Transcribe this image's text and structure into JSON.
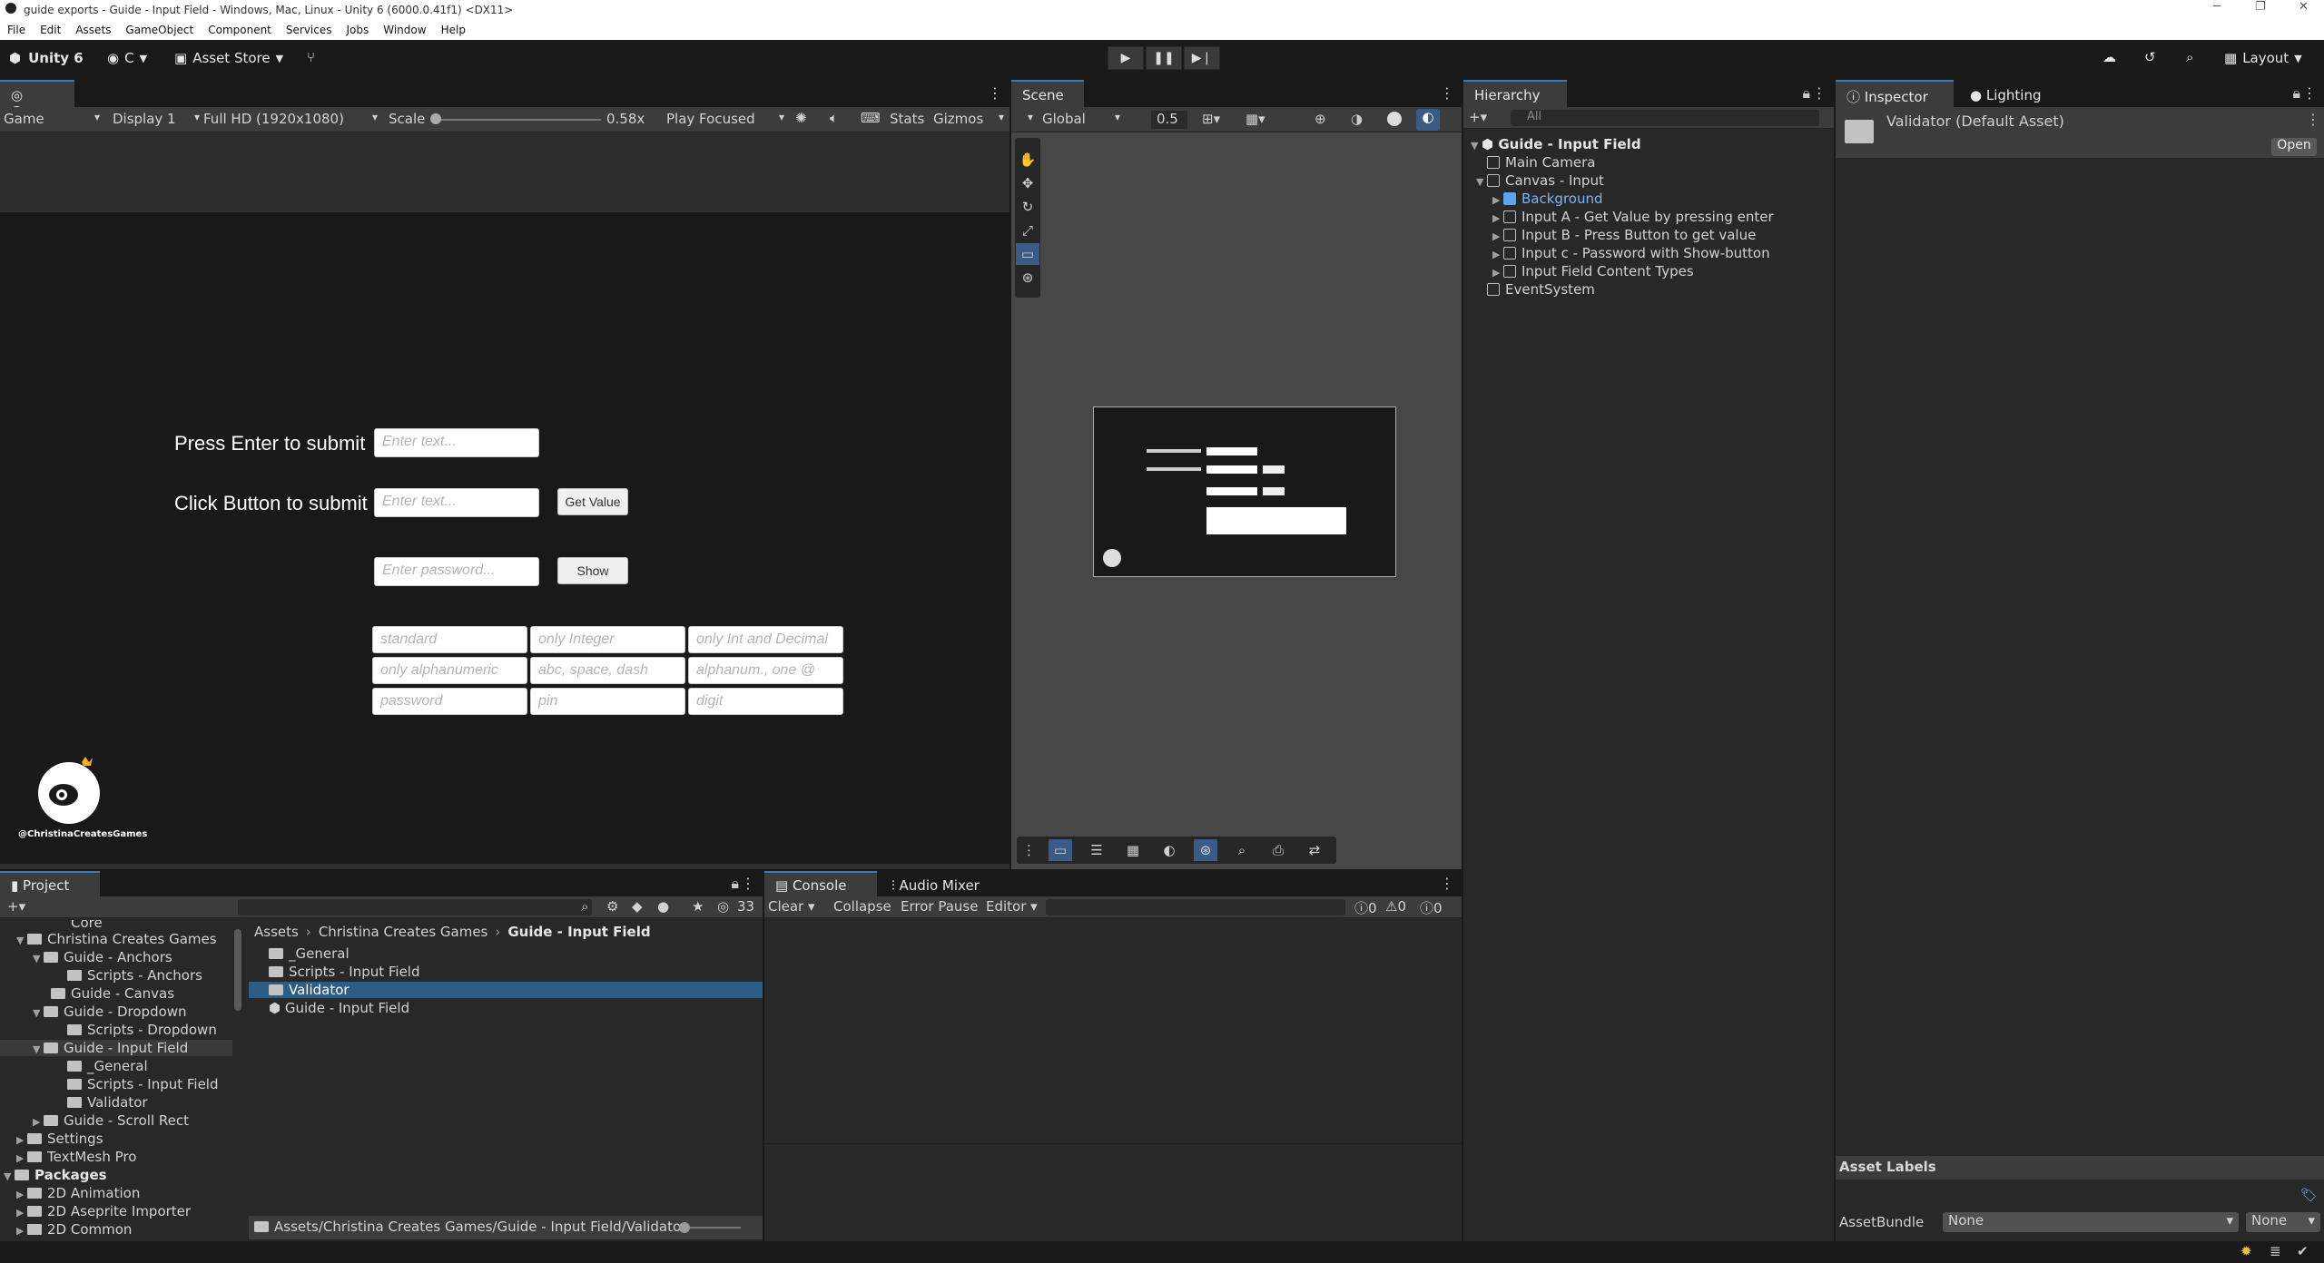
{
  "title_bar": {
    "title": "guide exports - Guide - Input Field - Windows, Mac, Linux - Unity 6 (6000.0.41f1) <DX11>"
  },
  "menu": [
    "File",
    "Edit",
    "Assets",
    "GameObject",
    "Component",
    "Services",
    "Jobs",
    "Window",
    "Help"
  ],
  "toolbar": {
    "unity": "Unity 6",
    "account": "C",
    "asset_store": "Asset Store",
    "layout": "Layout"
  },
  "game": {
    "tab": "Game",
    "mode": "Game",
    "display": "Display 1",
    "resolution": "Full HD (1920x1080)",
    "scale_label": "Scale",
    "scale_value": "0.58x",
    "play_mode": "Play Focused",
    "stats": "Stats",
    "gizmos": "Gizmos",
    "label_enter": "Press Enter to submit",
    "label_click": "Click Button to submit",
    "ph_enter": "Enter text...",
    "ph_click": "Enter text...",
    "btn_get": "Get Value",
    "ph_password": "Enter password...",
    "btn_show": "Show",
    "grid": [
      "standard",
      "only Integer",
      "only Int and Decimal",
      "only alphanumeric",
      "abc, space, dash",
      "alphanum., one @",
      "password",
      "pin",
      "digit"
    ],
    "logo_text": "@ChristinaCreatesGames"
  },
  "scene": {
    "tab": "Scene",
    "global": "Global",
    "snap": "0.5"
  },
  "hierarchy": {
    "tab": "Hierarchy",
    "search": "All",
    "scene": "Guide - Input Field",
    "items": [
      "Main Camera",
      "Canvas - Input",
      "Background",
      "Input A - Get Value by pressing enter",
      "Input B - Press Button to get value",
      "Input c - Password with Show-button",
      "Input Field Content Types",
      "EventSystem"
    ]
  },
  "inspector": {
    "tab": "Inspector",
    "tab2": "Lighting",
    "asset": "Validator (Default Asset)",
    "open": "Open",
    "labels": "Asset Labels",
    "bundle": "AssetBundle",
    "bundle_val": "None",
    "variant_val": "None"
  },
  "project": {
    "tab": "Project",
    "count": "33",
    "tree": [
      "Core",
      "Christina Creates Games",
      "Guide - Anchors",
      "Scripts - Anchors",
      "Guide - Canvas",
      "Guide - Dropdown",
      "Scripts - Dropdown",
      "Guide - Input Field",
      "_General",
      "Scripts - Input Field",
      "Validator",
      "Guide - Scroll Rect",
      "Settings",
      "TextMesh Pro",
      "Packages",
      "2D Animation",
      "2D Aseprite Importer",
      "2D Common"
    ],
    "breadcrumb": [
      "Assets",
      "Christina Creates Games",
      "Guide - Input Field"
    ],
    "files": [
      "_General",
      "Scripts - Input Field",
      "Validator",
      "Guide - Input Field"
    ],
    "path": "Assets/Christina Creates Games/Guide - Input Field/Validator"
  },
  "console": {
    "tab": "Console",
    "tab2": "Audio Mixer",
    "clear": "Clear",
    "collapse": "Collapse",
    "error_pause": "Error Pause",
    "editor": "Editor",
    "c1": "0",
    "c2": "0",
    "c3": "0"
  },
  "colors": {
    "accent": "#3a79bb",
    "selected": "#2c5d87",
    "panel": "#282828"
  }
}
